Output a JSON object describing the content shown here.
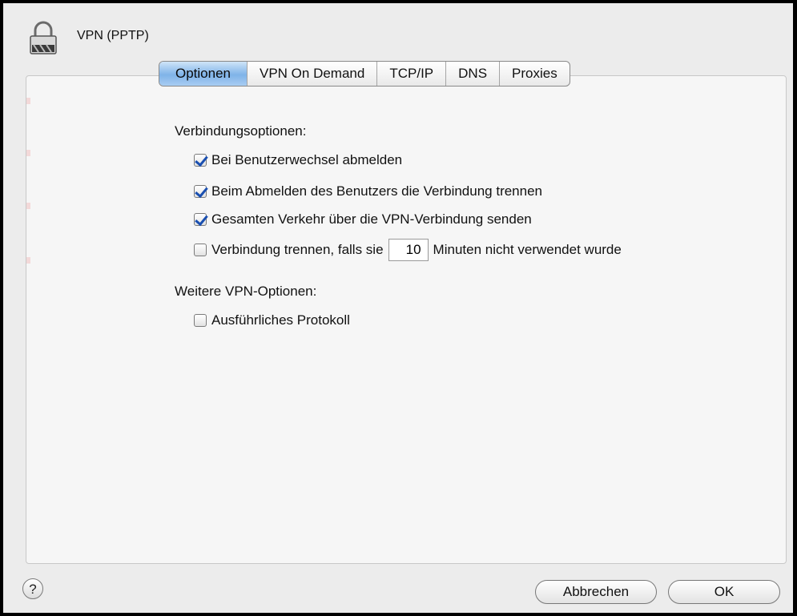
{
  "window": {
    "title": "VPN (PPTP)",
    "icon": "lock-icon"
  },
  "tabs": [
    {
      "label": "Optionen",
      "active": true
    },
    {
      "label": "VPN On Demand",
      "active": false
    },
    {
      "label": "TCP/IP",
      "active": false
    },
    {
      "label": "DNS",
      "active": false
    },
    {
      "label": "Proxies",
      "active": false
    }
  ],
  "connection_options": {
    "heading": "Verbindungsoptionen:",
    "items": [
      {
        "label": "Bei Benutzerwechsel abmelden",
        "checked": true
      },
      {
        "label": "Beim Abmelden des Benutzers die Verbindung trennen",
        "checked": true
      },
      {
        "label": "Gesamten Verkehr über die VPN-Verbindung senden",
        "checked": true
      }
    ],
    "idle": {
      "checked": false,
      "label_before": "Verbindung trennen, falls sie",
      "minutes_value": "10",
      "label_after": "Minuten nicht verwendet wurde"
    }
  },
  "more_options": {
    "heading": "Weitere VPN-Optionen:",
    "items": [
      {
        "label": "Ausführliches Protokoll",
        "checked": false
      }
    ]
  },
  "buttons": {
    "help": "?",
    "cancel": "Abbrechen",
    "ok": "OK"
  },
  "colors": {
    "accent": "#7fb3e8",
    "check": "#1a4fb0",
    "background": "#ececec"
  }
}
